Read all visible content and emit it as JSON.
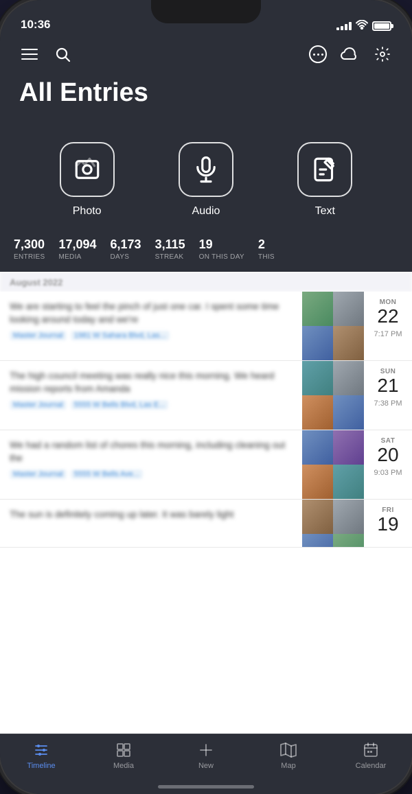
{
  "status_bar": {
    "time": "10:36",
    "signal_bars": [
      3,
      4,
      5,
      6
    ],
    "battery_full": true
  },
  "header": {
    "title": "All Entries",
    "menu_icon": "hamburger",
    "search_icon": "search",
    "more_icon": "ellipsis",
    "cloud_icon": "cloud",
    "settings_icon": "gear"
  },
  "entry_types": [
    {
      "id": "photo",
      "label": "Photo",
      "icon": "photo"
    },
    {
      "id": "audio",
      "label": "Audio",
      "icon": "mic"
    },
    {
      "id": "text",
      "label": "Text",
      "icon": "edit"
    }
  ],
  "stats": [
    {
      "value": "7,300",
      "label": "ENTRIES"
    },
    {
      "value": "17,094",
      "label": "MEDIA"
    },
    {
      "value": "6,173",
      "label": "DAYS"
    },
    {
      "value": "3,115",
      "label": "STREAK"
    },
    {
      "value": "19",
      "label": "ON THIS DAY"
    },
    {
      "value": "2",
      "label": "THIS"
    }
  ],
  "date_header": "August 2022",
  "entries": [
    {
      "text": "We are starting to feel the pinch of just one car. I spent some time looking around today and we're",
      "tags": [
        "Master Journal",
        "1981 W Sahara Blvd, Las..."
      ],
      "day_name": "MON",
      "day_num": "22",
      "time": "7:17 PM",
      "thumb_colors": [
        "green",
        "gray",
        "blue",
        "brown"
      ]
    },
    {
      "text": "The high council meeting was really nice this morning. We heard mission reports from Amanda",
      "tags": [
        "Master Journal",
        "5555 W Bells Blvd, Las E..."
      ],
      "day_name": "SUN",
      "day_num": "21",
      "time": "7:38 PM",
      "thumb_colors": [
        "teal",
        "gray",
        "orange",
        "blue"
      ]
    },
    {
      "text": "We had a random list of chores this morning, including cleaning out the",
      "tags": [
        "Master Journal",
        "5555 W Bells Ave..."
      ],
      "day_name": "SAT",
      "day_num": "20",
      "time": "9:03 PM",
      "thumb_colors": [
        "blue",
        "purple",
        "orange",
        "teal"
      ]
    },
    {
      "text": "The sun is definitely coming up later. It was barely light",
      "tags": [],
      "day_name": "FRI",
      "day_num": "19",
      "time": "",
      "thumb_colors": [
        "brown",
        "gray",
        "blue",
        "green"
      ]
    }
  ],
  "tab_bar": {
    "items": [
      {
        "id": "timeline",
        "label": "Timeline",
        "icon": "timeline",
        "active": true
      },
      {
        "id": "media",
        "label": "Media",
        "icon": "grid"
      },
      {
        "id": "new",
        "label": "New",
        "icon": "plus"
      },
      {
        "id": "map",
        "label": "Map",
        "icon": "map"
      },
      {
        "id": "calendar",
        "label": "Calendar",
        "icon": "calendar"
      }
    ]
  }
}
